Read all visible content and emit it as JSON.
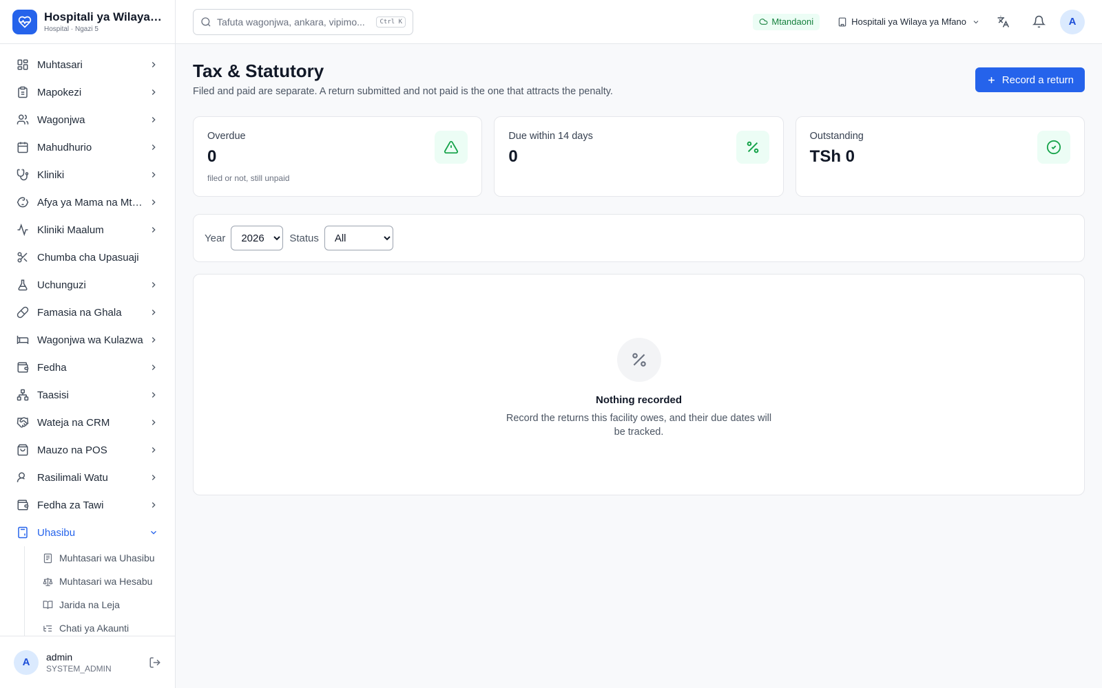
{
  "brand": {
    "name": "Hospitali ya Wilaya ya Mfano",
    "sub": "Hospital · Ngazi 5"
  },
  "nav": [
    {
      "label": "Muhtasari",
      "icon": "dashboard-icon"
    },
    {
      "label": "Mapokezi",
      "icon": "clipboard-icon"
    },
    {
      "label": "Wagonjwa",
      "icon": "users-icon"
    },
    {
      "label": "Mahudhurio",
      "icon": "calendar-icon"
    },
    {
      "label": "Kliniki",
      "icon": "stethoscope-icon"
    },
    {
      "label": "Afya ya Mama na Mtoto",
      "icon": "baby-icon"
    },
    {
      "label": "Kliniki Maalum",
      "icon": "activity-icon"
    },
    {
      "label": "Chumba cha Upasuaji",
      "icon": "scissors-icon"
    },
    {
      "label": "Uchunguzi",
      "icon": "flask-icon"
    },
    {
      "label": "Famasia na Ghala",
      "icon": "pill-icon"
    },
    {
      "label": "Wagonjwa wa Kulazwa",
      "icon": "bed-icon"
    },
    {
      "label": "Fedha",
      "icon": "wallet-icon"
    },
    {
      "label": "Taasisi",
      "icon": "org-chart-icon"
    },
    {
      "label": "Wateja na CRM",
      "icon": "handshake-icon"
    },
    {
      "label": "Mauzo na POS",
      "icon": "shopping-bag-icon"
    },
    {
      "label": "Rasilimali Watu",
      "icon": "user-icon"
    },
    {
      "label": "Fedha za Tawi",
      "icon": "wallet-icon"
    },
    {
      "label": "Uhasibu",
      "icon": "calculator-icon"
    }
  ],
  "subnav": [
    {
      "label": "Muhtasari wa Uhasibu",
      "icon": "receipt-icon"
    },
    {
      "label": "Muhtasari wa Hesabu",
      "icon": "scale-icon"
    },
    {
      "label": "Jarida na Leja",
      "icon": "book-icon"
    },
    {
      "label": "Chati ya Akaunti",
      "icon": "list-tree-icon"
    }
  ],
  "user": {
    "name": "admin",
    "role": "SYSTEM_ADMIN",
    "initial": "A"
  },
  "topbar": {
    "search_placeholder": "Tafuta wagonjwa, ankara, vipimo...",
    "shortcut": "Ctrl K",
    "status": "Mtandaoni",
    "facility": "Hospitali ya Wilaya ya Mfano",
    "avatar_initial": "A"
  },
  "page": {
    "title": "Tax & Statutory",
    "subtitle": "Filed and paid are separate. A return submitted and not paid is the one that attracts the penalty.",
    "primary_action": "Record a return"
  },
  "stats": [
    {
      "label": "Overdue",
      "value": "0",
      "note": "filed or not, still unpaid",
      "icon": "alert-triangle-icon"
    },
    {
      "label": "Due within 14 days",
      "value": "0",
      "note": "",
      "icon": "percent-icon"
    },
    {
      "label": "Outstanding",
      "value": "TSh 0",
      "note": "",
      "icon": "check-circle-icon"
    }
  ],
  "filters": {
    "year_label": "Year",
    "year_value": "2026",
    "status_label": "Status",
    "status_value": "All"
  },
  "empty": {
    "title": "Nothing recorded",
    "description": "Record the returns this facility owes, and their due dates will be tracked."
  },
  "colors": {
    "accent": "#2563eb",
    "success_bg": "#ecfdf5",
    "success": "#16a34a"
  }
}
